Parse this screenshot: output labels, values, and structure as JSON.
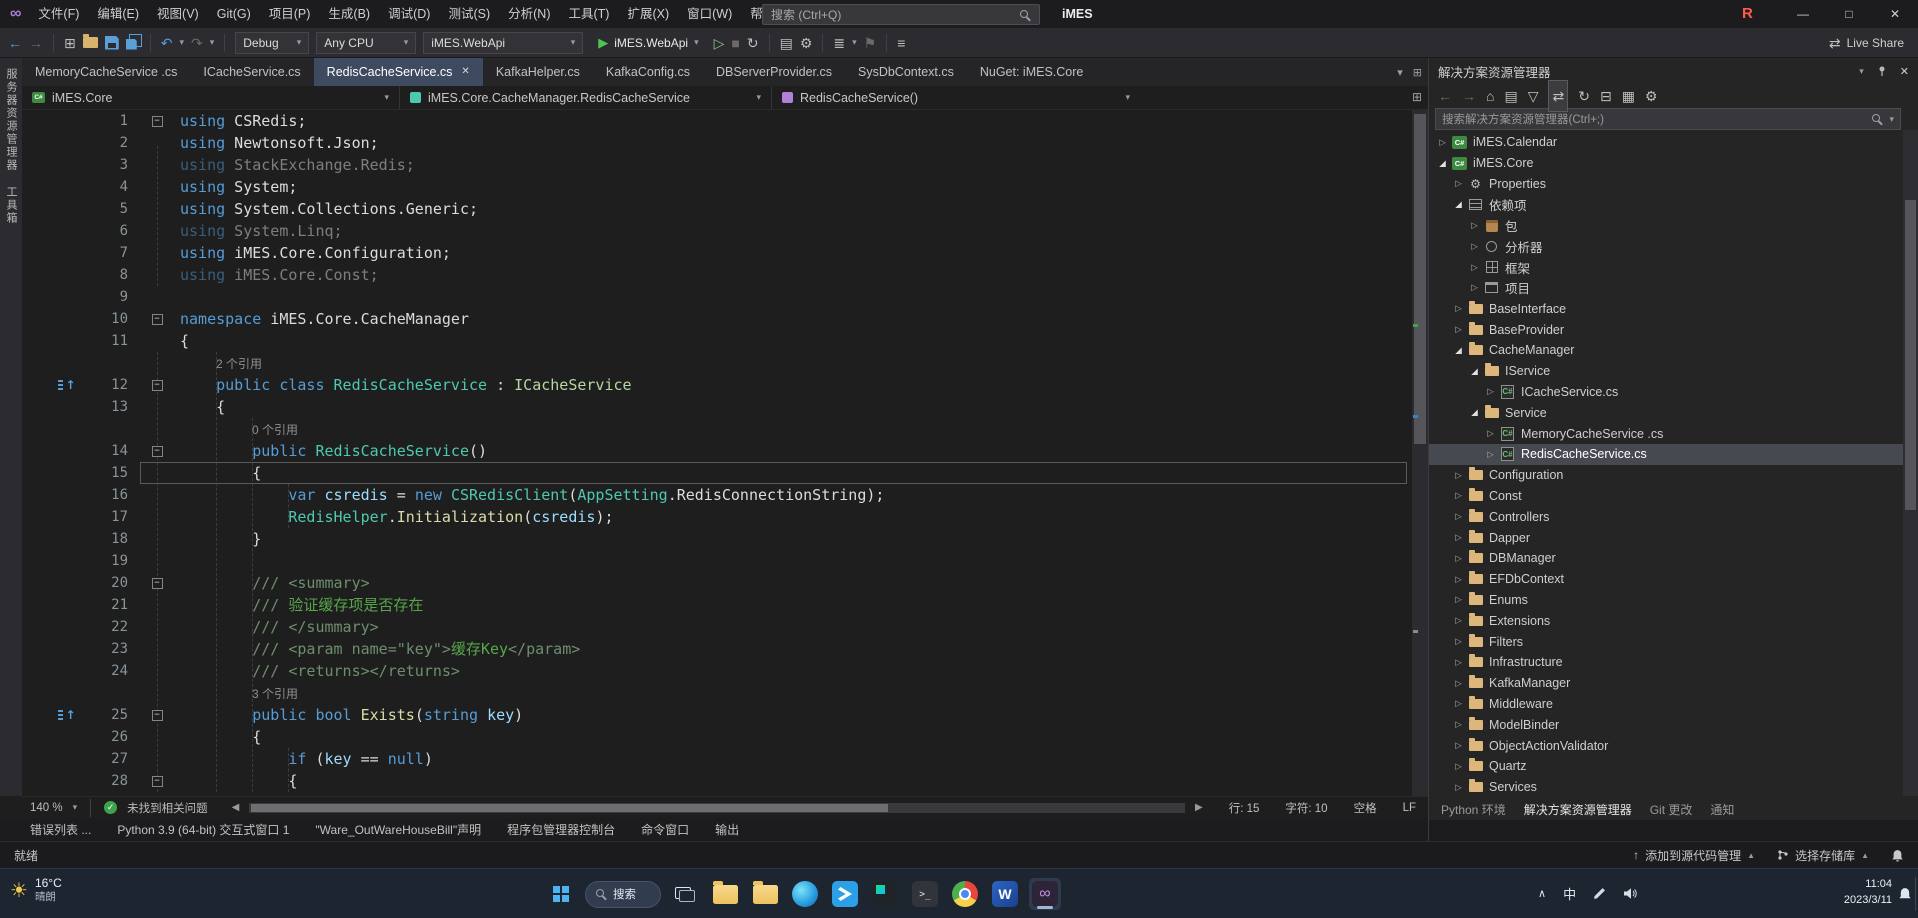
{
  "titlebar": {
    "logo": "∞",
    "menu_items": [
      "文件(F)",
      "编辑(E)",
      "视图(V)",
      "Git(G)",
      "项目(P)",
      "生成(B)",
      "调试(D)",
      "测试(S)",
      "分析(N)",
      "工具(T)",
      "扩展(X)",
      "窗口(W)",
      "帮助(H)"
    ],
    "search_placeholder": "搜索 (Ctrl+Q)",
    "solution_name": "iMES",
    "r_badge": "R",
    "minimize": "—",
    "maximize": "□",
    "close": "✕"
  },
  "toolbar": {
    "config": "Debug",
    "platform": "Any CPU",
    "startup_project": "iMES.WebApi",
    "run_label": "iMES.WebApi",
    "live_share": "Live Share"
  },
  "side_strip": {
    "labels": [
      "服务器资源管理器",
      "工具箱"
    ]
  },
  "doc_tabs": [
    {
      "label": "MemoryCacheService .cs"
    },
    {
      "label": "ICacheService.cs"
    },
    {
      "label": "RedisCacheService.cs",
      "active": true
    },
    {
      "label": "KafkaHelper.cs"
    },
    {
      "label": "KafkaConfig.cs"
    },
    {
      "label": "DBServerProvider.cs"
    },
    {
      "label": "SysDbContext.cs"
    },
    {
      "label": "NuGet: iMES.Core"
    }
  ],
  "breadcrumb": {
    "project": "iMES.Core",
    "type": "iMES.Core.CacheManager.RedisCacheService",
    "member": "RedisCacheService()"
  },
  "editor": {
    "rows": [
      {
        "n": "1",
        "f": 1,
        "s": [
          [
            "k",
            "using"
          ],
          [
            "t",
            " CSRedis;"
          ]
        ]
      },
      {
        "n": "2",
        "s": [
          [
            "k",
            "using"
          ],
          [
            "t",
            " Newtonsoft.Json;"
          ]
        ]
      },
      {
        "n": "3",
        "dim": 1,
        "s": [
          [
            "k",
            "using"
          ],
          [
            "t",
            " StackExchange.Redis;"
          ]
        ]
      },
      {
        "n": "4",
        "s": [
          [
            "k",
            "using"
          ],
          [
            "t",
            " System;"
          ]
        ]
      },
      {
        "n": "5",
        "s": [
          [
            "k",
            "using"
          ],
          [
            "t",
            " System.Collections.Generic;"
          ]
        ]
      },
      {
        "n": "6",
        "dim": 1,
        "s": [
          [
            "k",
            "using"
          ],
          [
            "t",
            " System.Linq;"
          ]
        ]
      },
      {
        "n": "7",
        "s": [
          [
            "k",
            "using"
          ],
          [
            "t",
            " iMES.Core.Configuration;"
          ]
        ]
      },
      {
        "n": "8",
        "dim": 1,
        "s": [
          [
            "k",
            "using"
          ],
          [
            "t",
            " iMES.Core.Const;"
          ]
        ]
      },
      {
        "n": "9",
        "s": []
      },
      {
        "n": "10",
        "f": 1,
        "s": [
          [
            "k",
            "namespace"
          ],
          [
            "t",
            " iMES.Core.CacheManager"
          ]
        ]
      },
      {
        "n": "11",
        "s": [
          [
            "t",
            "{"
          ]
        ]
      },
      {
        "lens": "2 个引用",
        "ind": 4
      },
      {
        "n": "12",
        "f": 1,
        "ic": 1,
        "s": [
          [
            "t",
            "    "
          ],
          [
            "k",
            "public"
          ],
          [
            "t",
            " "
          ],
          [
            "k",
            "class"
          ],
          [
            "t",
            " "
          ],
          [
            "ty",
            "RedisCacheService"
          ],
          [
            "t",
            " : "
          ],
          [
            "if",
            "ICacheService"
          ]
        ]
      },
      {
        "n": "13",
        "s": [
          [
            "t",
            "    {"
          ]
        ]
      },
      {
        "lens": "0 个引用",
        "ind": 8
      },
      {
        "n": "14",
        "f": 1,
        "s": [
          [
            "t",
            "        "
          ],
          [
            "k",
            "public"
          ],
          [
            "t",
            " "
          ],
          [
            "ty",
            "RedisCacheService"
          ],
          [
            "t",
            "()"
          ]
        ]
      },
      {
        "n": "15",
        "cur": 1,
        "s": [
          [
            "t",
            "        {"
          ]
        ]
      },
      {
        "n": "16",
        "s": [
          [
            "t",
            "            "
          ],
          [
            "k",
            "var"
          ],
          [
            "t",
            " "
          ],
          [
            "v",
            "csredis"
          ],
          [
            "t",
            " = "
          ],
          [
            "k",
            "new"
          ],
          [
            "t",
            " "
          ],
          [
            "ty",
            "CSRedisClient"
          ],
          [
            "t",
            "("
          ],
          [
            "ty",
            "AppSetting"
          ],
          [
            "t",
            ".RedisConnectionString);"
          ]
        ]
      },
      {
        "n": "17",
        "s": [
          [
            "t",
            "            "
          ],
          [
            "ty",
            "RedisHelper"
          ],
          [
            "t",
            "."
          ],
          [
            "m",
            "Initialization"
          ],
          [
            "t",
            "("
          ],
          [
            "v",
            "csredis"
          ],
          [
            "t",
            ");"
          ]
        ]
      },
      {
        "n": "18",
        "s": [
          [
            "t",
            "        }"
          ]
        ]
      },
      {
        "n": "19",
        "s": []
      },
      {
        "n": "20",
        "f": 1,
        "s": [
          [
            "t",
            "        "
          ],
          [
            "dg",
            "/// <summary>"
          ]
        ]
      },
      {
        "n": "21",
        "s": [
          [
            "t",
            "        "
          ],
          [
            "dg",
            "/// "
          ],
          [
            "dc",
            "验证缓存项是否存在"
          ]
        ]
      },
      {
        "n": "22",
        "s": [
          [
            "t",
            "        "
          ],
          [
            "dg",
            "/// </summary>"
          ]
        ]
      },
      {
        "n": "23",
        "s": [
          [
            "t",
            "        "
          ],
          [
            "dg",
            "/// <param name=\"key\">"
          ],
          [
            "dc",
            "缓存Key"
          ],
          [
            "dg",
            "</param>"
          ]
        ]
      },
      {
        "n": "24",
        "s": [
          [
            "t",
            "        "
          ],
          [
            "dg",
            "/// <returns></returns>"
          ]
        ]
      },
      {
        "lens": "3 个引用",
        "ind": 8
      },
      {
        "n": "25",
        "f": 1,
        "ic": 1,
        "s": [
          [
            "t",
            "        "
          ],
          [
            "k",
            "public"
          ],
          [
            "t",
            " "
          ],
          [
            "k",
            "bool"
          ],
          [
            "t",
            " "
          ],
          [
            "m",
            "Exists"
          ],
          [
            "t",
            "("
          ],
          [
            "k",
            "string"
          ],
          [
            "t",
            " "
          ],
          [
            "v",
            "key"
          ],
          [
            "t",
            ")"
          ]
        ]
      },
      {
        "n": "26",
        "s": [
          [
            "t",
            "        {"
          ]
        ]
      },
      {
        "n": "27",
        "s": [
          [
            "t",
            "            "
          ],
          [
            "k",
            "if"
          ],
          [
            "t",
            " ("
          ],
          [
            "v",
            "key"
          ],
          [
            "t",
            " == "
          ],
          [
            "k",
            "null"
          ],
          [
            "t",
            ")"
          ]
        ]
      },
      {
        "n": "28",
        "f": 1,
        "s": [
          [
            "t",
            "            {"
          ]
        ]
      }
    ],
    "status": {
      "zoom": "140 %",
      "problems": "未找到相关问题",
      "line": "行: 15",
      "col": "字符: 10",
      "space": "空格",
      "eol": "LF"
    }
  },
  "bottom_tabs": [
    "错误列表 ...",
    "Python 3.9 (64-bit) 交互式窗口 1",
    "\"Ware_OutWareHouseBill\"声明",
    "程序包管理器控制台",
    "命令窗口",
    "输出"
  ],
  "solution_explorer": {
    "title": "解决方案资源管理器",
    "search_placeholder": "搜索解决方案资源管理器(Ctrl+;)",
    "tree": [
      {
        "d": 0,
        "a": "c",
        "ic": "proj",
        "t": "iMES.Calendar"
      },
      {
        "d": 0,
        "a": "e",
        "ic": "proj",
        "t": "iMES.Core"
      },
      {
        "d": 1,
        "a": "c",
        "ic": "props",
        "t": "Properties"
      },
      {
        "d": 1,
        "a": "e",
        "ic": "dep",
        "t": "依赖项"
      },
      {
        "d": 2,
        "a": "c",
        "ic": "pkg",
        "t": "包"
      },
      {
        "d": 2,
        "a": "c",
        "ic": "ana",
        "t": "分析器"
      },
      {
        "d": 2,
        "a": "c",
        "ic": "fw",
        "t": "框架"
      },
      {
        "d": 2,
        "a": "c",
        "ic": "prj",
        "t": "项目"
      },
      {
        "d": 1,
        "a": "c",
        "ic": "folder",
        "t": "BaseInterface"
      },
      {
        "d": 1,
        "a": "c",
        "ic": "folder",
        "t": "BaseProvider"
      },
      {
        "d": 1,
        "a": "e",
        "ic": "folder",
        "t": "CacheManager"
      },
      {
        "d": 2,
        "a": "e",
        "ic": "folder",
        "t": "IService"
      },
      {
        "d": 3,
        "a": "c",
        "ic": "cs",
        "t": "ICacheService.cs"
      },
      {
        "d": 2,
        "a": "e",
        "ic": "folder",
        "t": "Service"
      },
      {
        "d": 3,
        "a": "c",
        "ic": "cs",
        "t": "MemoryCacheService .cs"
      },
      {
        "d": 3,
        "a": "c",
        "ic": "cs",
        "t": "RedisCacheService.cs",
        "sel": 1
      },
      {
        "d": 1,
        "a": "c",
        "ic": "folder",
        "t": "Configuration"
      },
      {
        "d": 1,
        "a": "c",
        "ic": "folder",
        "t": "Const"
      },
      {
        "d": 1,
        "a": "c",
        "ic": "folder",
        "t": "Controllers"
      },
      {
        "d": 1,
        "a": "c",
        "ic": "folder",
        "t": "Dapper"
      },
      {
        "d": 1,
        "a": "c",
        "ic": "folder",
        "t": "DBManager"
      },
      {
        "d": 1,
        "a": "c",
        "ic": "folder",
        "t": "EFDbContext"
      },
      {
        "d": 1,
        "a": "c",
        "ic": "folder",
        "t": "Enums"
      },
      {
        "d": 1,
        "a": "c",
        "ic": "folder",
        "t": "Extensions"
      },
      {
        "d": 1,
        "a": "c",
        "ic": "folder",
        "t": "Filters"
      },
      {
        "d": 1,
        "a": "c",
        "ic": "folder",
        "t": "Infrastructure"
      },
      {
        "d": 1,
        "a": "c",
        "ic": "folder",
        "t": "KafkaManager"
      },
      {
        "d": 1,
        "a": "c",
        "ic": "folder",
        "t": "Middleware"
      },
      {
        "d": 1,
        "a": "c",
        "ic": "folder",
        "t": "ModelBinder"
      },
      {
        "d": 1,
        "a": "c",
        "ic": "folder",
        "t": "ObjectActionValidator"
      },
      {
        "d": 1,
        "a": "c",
        "ic": "folder",
        "t": "Quartz"
      },
      {
        "d": 1,
        "a": "c",
        "ic": "folder",
        "t": "Services"
      }
    ],
    "panel_tabs": [
      {
        "label": "Python 环境"
      },
      {
        "label": "解决方案资源管理器",
        "active": true
      },
      {
        "label": "Git 更改"
      },
      {
        "label": "通知"
      }
    ]
  },
  "status_bar": {
    "ready": "就绪",
    "add_to_source_control": "添加到源代码管理",
    "select_repo": "选择存储库"
  },
  "taskbar": {
    "weather_temp": "16°C",
    "weather_desc": "晴朗",
    "search_label": "搜索",
    "ime": "中",
    "time": "11:04",
    "date": "2023/3/11"
  },
  "icons": {
    "sun": "☀",
    "back": "←",
    "forward": "→",
    "undo": "↶",
    "redo": "↷",
    "caret": "▾",
    "caret_up": "▲",
    "run": "▶",
    "run_outline": "▷",
    "stop": "■",
    "refresh": "↻",
    "gear": "⚙",
    "rows": "▤",
    "menu": "≡",
    "list": "≣",
    "bookmark": "⚑",
    "new_window": "⊞",
    "home": "⌂",
    "sync": "⇄",
    "filter": "▽",
    "collapse_all": "⊟",
    "show_all": "▦",
    "close": "✕",
    "minus": "−",
    "check": "✓",
    "chevron_up": "∧",
    "left": "◀",
    "right": "▶",
    "up": "↑",
    "tri_c": "▷",
    "tri_e": "◢",
    "cs_label": "C#",
    "word": "W",
    "infinity": "∞",
    "prompt": "&gt;_"
  }
}
